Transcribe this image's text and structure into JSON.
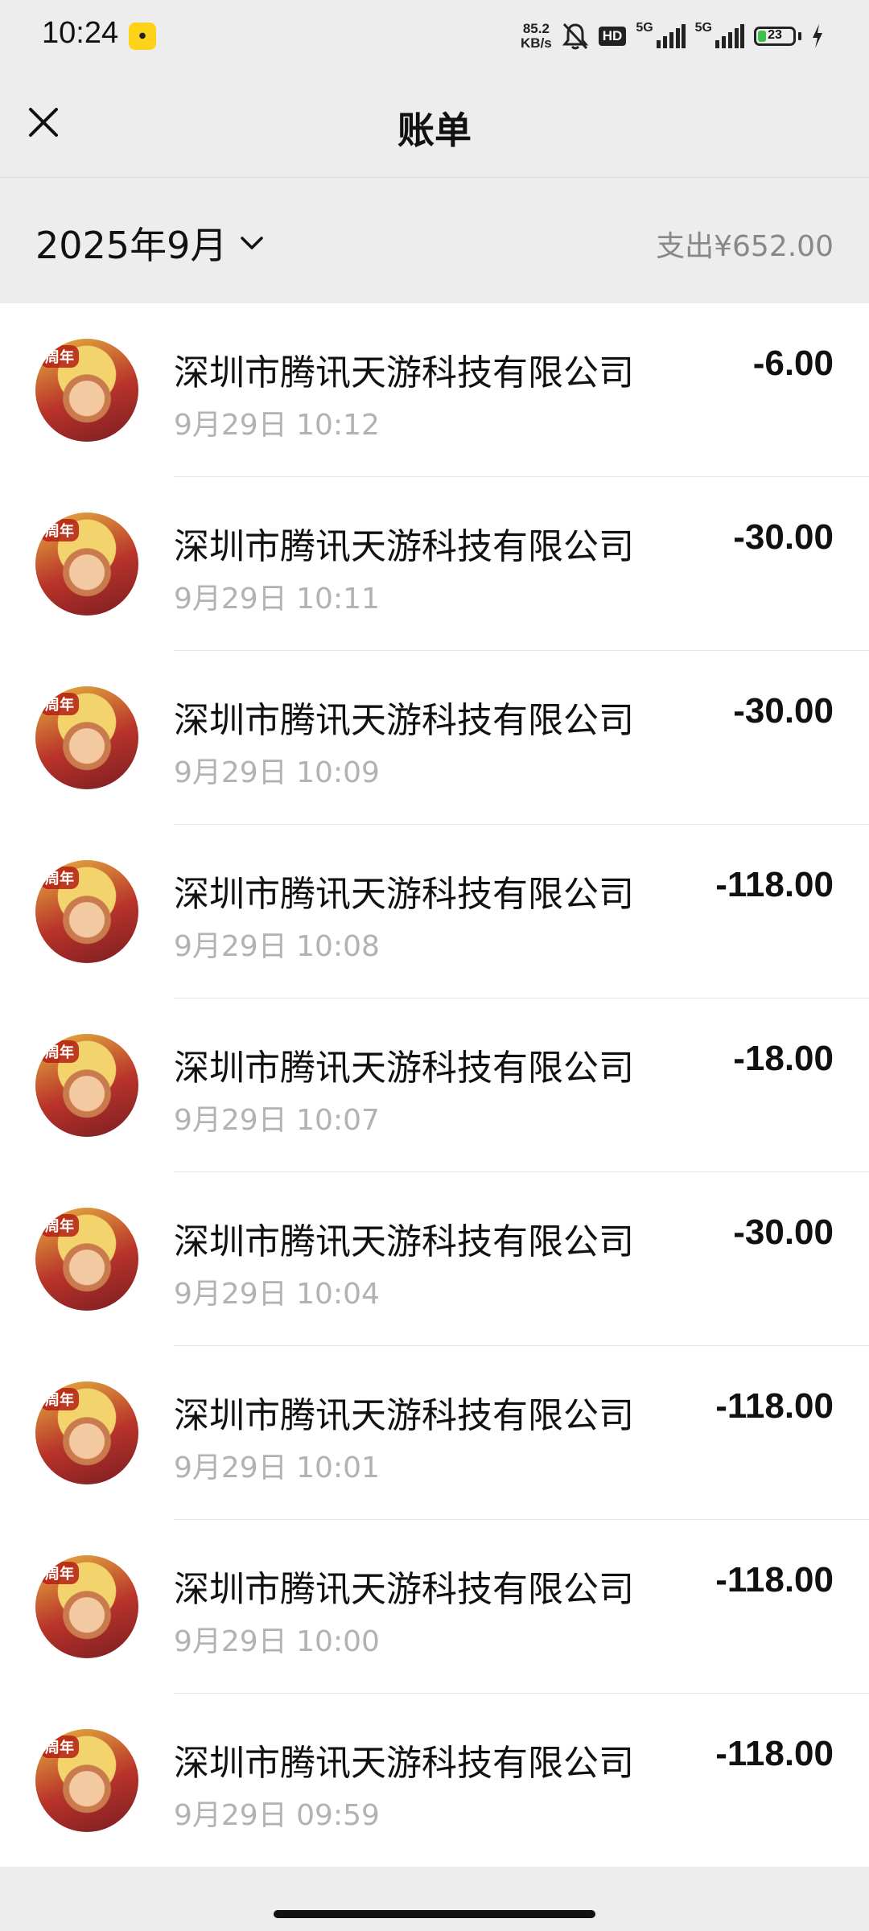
{
  "status_bar": {
    "time": "10:24",
    "app_notification_icon": "yellow-app-icon",
    "net_speed_value": "85.2",
    "net_speed_unit": "KB/s",
    "hd_label": "HD",
    "signal1_label": "5G",
    "signal2_label": "5G",
    "battery_level": "23",
    "battery_fraction": 0.23
  },
  "nav": {
    "title": "账单",
    "close_icon": "close-icon"
  },
  "summary": {
    "month": "2025年9月",
    "total": "支出¥652.00"
  },
  "transactions": [
    {
      "merchant": "深圳市腾讯天游科技有限公司",
      "datetime": "9月29日 10:12",
      "amount": "-6.00"
    },
    {
      "merchant": "深圳市腾讯天游科技有限公司",
      "datetime": "9月29日 10:11",
      "amount": "-30.00"
    },
    {
      "merchant": "深圳市腾讯天游科技有限公司",
      "datetime": "9月29日 10:09",
      "amount": "-30.00"
    },
    {
      "merchant": "深圳市腾讯天游科技有限公司",
      "datetime": "9月29日 10:08",
      "amount": "-118.00"
    },
    {
      "merchant": "深圳市腾讯天游科技有限公司",
      "datetime": "9月29日 10:07",
      "amount": "-18.00"
    },
    {
      "merchant": "深圳市腾讯天游科技有限公司",
      "datetime": "9月29日 10:04",
      "amount": "-30.00"
    },
    {
      "merchant": "深圳市腾讯天游科技有限公司",
      "datetime": "9月29日 10:01",
      "amount": "-118.00"
    },
    {
      "merchant": "深圳市腾讯天游科技有限公司",
      "datetime": "9月29日 10:00",
      "amount": "-118.00"
    },
    {
      "merchant": "深圳市腾讯天游科技有限公司",
      "datetime": "9月29日 09:59",
      "amount": "-118.00"
    }
  ],
  "avatar_badge": "周年",
  "colors": {
    "background": "#ededed",
    "list_background": "#ffffff",
    "battery_green": "#3cc24a",
    "secondary_text": "#b2b2b2"
  }
}
